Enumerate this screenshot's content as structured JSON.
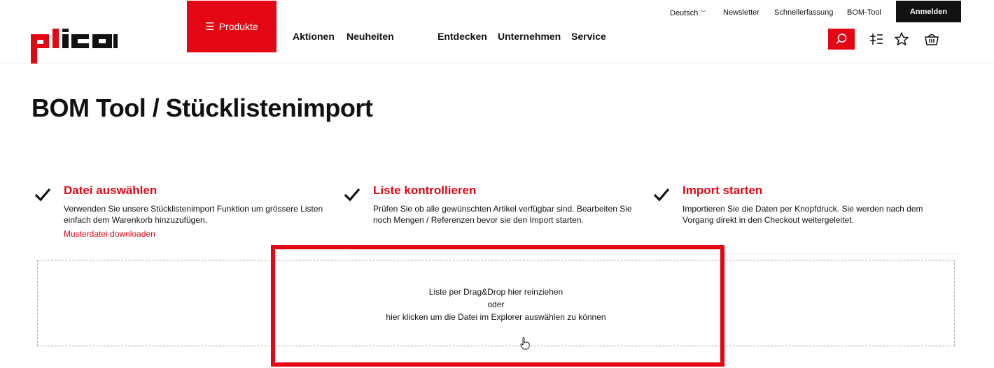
{
  "header": {
    "logo_text": "plica",
    "nav": {
      "produkte": "Produkte",
      "aktionen": "Aktionen",
      "neuheiten": "Neuheiten",
      "entdecken": "Entdecken",
      "unternehmen": "Unternehmen",
      "service": "Service"
    },
    "topbar": {
      "language": "Deutsch",
      "newsletter": "Newsletter",
      "schnellerfassung": "Schnellerfassung",
      "bom_tool": "BOM-Tool",
      "login": "Anmelden"
    },
    "icons": [
      "search-icon",
      "compare-icon",
      "star-icon",
      "basket-icon"
    ]
  },
  "main": {
    "title": "BOM Tool / Stücklistenimport",
    "steps": [
      {
        "title": "Datei auswählen",
        "text": "Verwenden Sie unsere Stücklistenimport Funktion um grössere Listen einfach dem Warenkorb hinzuzufügen.",
        "link": "Musterdatei downloaden"
      },
      {
        "title": "Liste kontrollieren",
        "text": "Prüfen Sie ob alle gewünschten Artikel verfügbar sind. Bearbeiten Sie noch Mengen / Referenzen bevor sie den Import starten."
      },
      {
        "title": "Import starten",
        "text": "Importieren Sie die Daten per Knopfdruck. Sie werden nach dem Vorgang direkt in den Checkout weitergeleitet."
      }
    ],
    "dropzone": {
      "line1": "Liste per Drag&Drop hier reinziehen",
      "line2": "oder",
      "line3": "hier klicken um die Datei im Explorer auswählen zu können"
    }
  },
  "colors": {
    "accent": "#e30613",
    "dark": "#111111",
    "border": "#aaaaaa"
  }
}
